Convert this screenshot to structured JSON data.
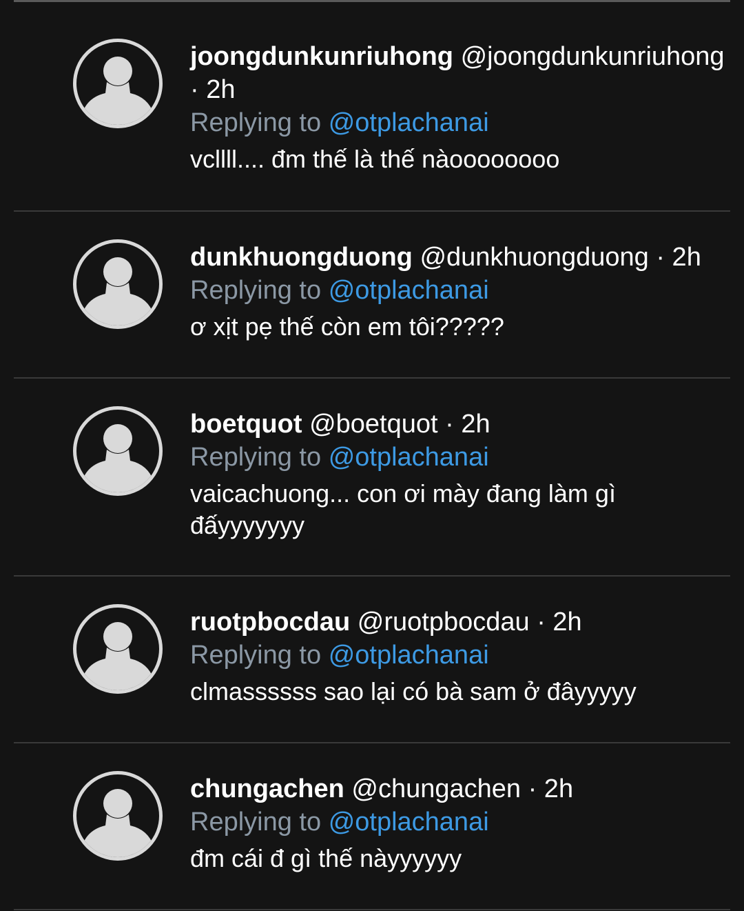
{
  "replies": [
    {
      "display_name": "joongdunkunriuhong",
      "handle": "@joongdunkunriuhong",
      "time": "· 2h",
      "replying_prefix": "Replying to",
      "replying_to": "@otplachanai",
      "text": "vcllll.... đm thế là thế nàoooooooo",
      "avatar_icon": "default-avatar-icon"
    },
    {
      "display_name": "dunkhuongduong",
      "handle": "@dunkhuongduong",
      "time": "· 2h",
      "replying_prefix": "Replying to",
      "replying_to": "@otplachanai",
      "text": "ơ xịt pẹ thế còn em tôi?????",
      "avatar_icon": "default-avatar-icon"
    },
    {
      "display_name": "boetquot",
      "handle": "@boetquot",
      "time": "· 2h",
      "replying_prefix": "Replying to",
      "replying_to": "@otplachanai",
      "text": "vaicachuong... con ơi mày đang làm gì đấyyyyyyy",
      "avatar_icon": "default-avatar-icon"
    },
    {
      "display_name": "ruotpbocdau",
      "handle": "@ruotpbocdau",
      "time": "· 2h",
      "replying_prefix": "Replying to",
      "replying_to": "@otplachanai",
      "text": "clmassssss sao lại có bà sam ở đâyyyyy",
      "avatar_icon": "default-avatar-icon"
    },
    {
      "display_name": "chungachen",
      "handle": "@chungachen",
      "time": "· 2h",
      "replying_prefix": "Replying to",
      "replying_to": "@otplachanai",
      "text": "đm cái đ gì thế nàyyyyyy",
      "avatar_icon": "default-avatar-icon"
    }
  ],
  "colors": {
    "background": "#141414",
    "name_text": "#ffffff",
    "muted_text": "#8b98a5",
    "mention": "#3d9ae4",
    "avatar": "#d9d9d9",
    "divider": "#3a3a3a"
  }
}
